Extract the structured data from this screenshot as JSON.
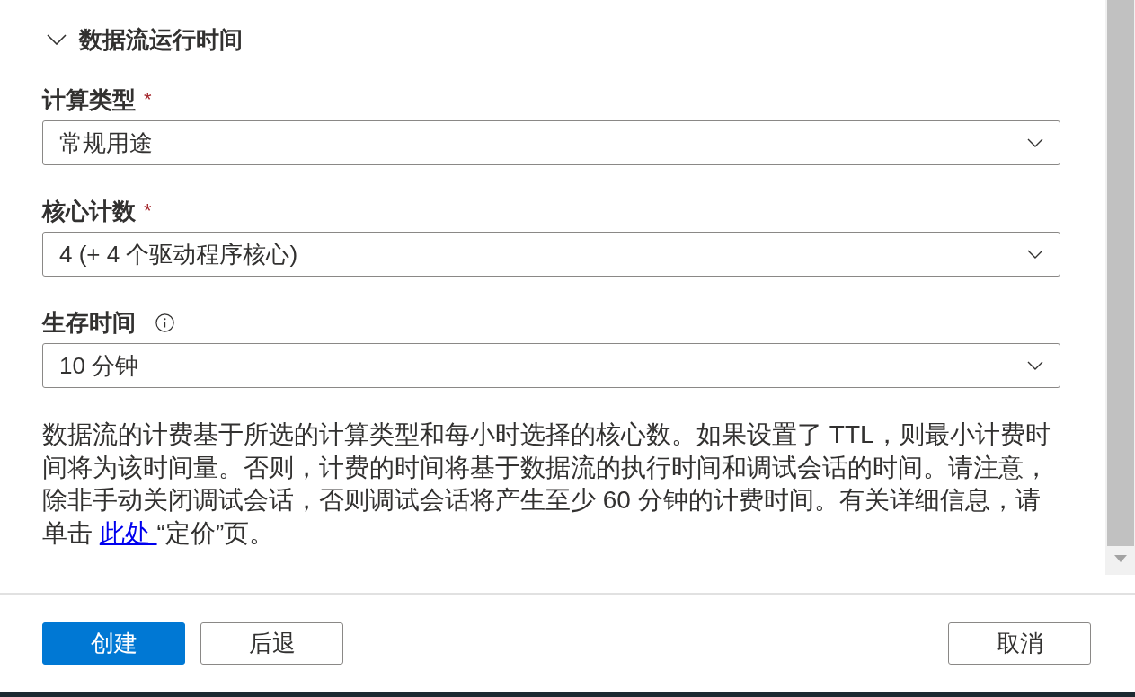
{
  "section": {
    "title": "数据流运行时间",
    "expanded": true
  },
  "fields": [
    {
      "label": "计算类型",
      "required_mark": "*",
      "info_icon": false,
      "value": "常规用途"
    },
    {
      "label": "核心计数",
      "required_mark": "*",
      "info_icon": false,
      "value": "4 (+ 4 个驱动程序核心)"
    },
    {
      "label": "生存时间",
      "info_icon": true,
      "value": "10 分钟"
    }
  ],
  "note": {
    "text": "数据流的计费基于所选的计算类型和每小时选择的核心数。如果设置了 TTL，则最小计费时间将为该时间量。否则，计费的时间将基于数据流的执行时间和调试会话的时间。请注意，除非手动关闭调试会话，否则调试会话将产生至少 60 分钟的计费时间。有关详细信息，请单击 ",
    "link": "此处 ",
    "text_after": "“定价”页。"
  },
  "footer": {
    "left_buttons": [
      {
        "label": "创建",
        "kind": "primary"
      },
      {
        "label": "后退",
        "kind": "secondary"
      }
    ],
    "right_buttons": [
      {
        "label": "取消",
        "kind": "secondary"
      }
    ]
  }
}
